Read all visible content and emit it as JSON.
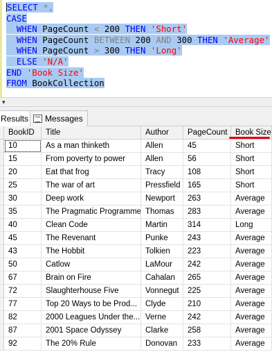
{
  "editor": {
    "lines": [
      [
        {
          "t": "SELECT",
          "c": "kw"
        },
        {
          "t": " *,",
          "c": "gry"
        }
      ],
      [
        {
          "t": "CASE",
          "c": "kw"
        }
      ],
      [
        {
          "t": "  WHEN ",
          "c": "kw"
        },
        {
          "t": "PageCount ",
          "c": ""
        },
        {
          "t": "< ",
          "c": "gry"
        },
        {
          "t": "200 ",
          "c": ""
        },
        {
          "t": "THEN ",
          "c": "kw"
        },
        {
          "t": "'Short'",
          "c": "str"
        }
      ],
      [
        {
          "t": "  WHEN ",
          "c": "kw"
        },
        {
          "t": "PageCount ",
          "c": ""
        },
        {
          "t": "BETWEEN ",
          "c": "gry"
        },
        {
          "t": "200 ",
          "c": ""
        },
        {
          "t": "AND ",
          "c": "gry"
        },
        {
          "t": "300 ",
          "c": ""
        },
        {
          "t": "THEN ",
          "c": "kw"
        },
        {
          "t": "'Average'",
          "c": "str"
        }
      ],
      [
        {
          "t": "  WHEN ",
          "c": "kw"
        },
        {
          "t": "PageCount ",
          "c": ""
        },
        {
          "t": "> ",
          "c": "gry"
        },
        {
          "t": "300 ",
          "c": ""
        },
        {
          "t": "THEN ",
          "c": "kw"
        },
        {
          "t": "'Long'",
          "c": "str"
        }
      ],
      [
        {
          "t": "  ELSE ",
          "c": "kw"
        },
        {
          "t": "'N/A'",
          "c": "str"
        }
      ],
      [
        {
          "t": "END ",
          "c": "kw"
        },
        {
          "t": "'Book Size'",
          "c": "str"
        }
      ],
      [
        {
          "t": "FROM ",
          "c": "kw"
        },
        {
          "t": "BookCollection",
          "c": ""
        }
      ]
    ]
  },
  "tabs": {
    "results": "Results",
    "messages": "Messages"
  },
  "grid": {
    "columns": [
      "BookID",
      "Title",
      "Author",
      "PageCount",
      "Book Size"
    ],
    "rows": [
      [
        "10",
        "As a man thinketh",
        "Allen",
        "45",
        "Short"
      ],
      [
        "15",
        "From poverty to power",
        "Allen",
        "56",
        "Short"
      ],
      [
        "20",
        "Eat that frog",
        "Tracy",
        "108",
        "Short"
      ],
      [
        "25",
        "The war of art",
        "Pressfield",
        "165",
        "Short"
      ],
      [
        "30",
        "Deep work",
        "Newport",
        "263",
        "Average"
      ],
      [
        "35",
        "The Pragmatic Programmer",
        "Thomas",
        "283",
        "Average"
      ],
      [
        "40",
        "Clean Code",
        "Martin",
        "314",
        "Long"
      ],
      [
        "45",
        "The Revenant",
        "Punke",
        "243",
        "Average"
      ],
      [
        "43",
        "The Hobbit",
        "Tolkien",
        "223",
        "Average"
      ],
      [
        "50",
        "Catlow",
        "LaMour",
        "242",
        "Average"
      ],
      [
        "67",
        "Brain on Fire",
        "Cahalan",
        "265",
        "Average"
      ],
      [
        "72",
        "Slaughterhouse Five",
        "Vonnegut",
        "225",
        "Average"
      ],
      [
        "77",
        "Top 20 Ways to be Prod...",
        "Clyde",
        "210",
        "Average"
      ],
      [
        "82",
        "2000 Leagues Under the...",
        "Verne",
        "242",
        "Average"
      ],
      [
        "87",
        "2001 Space Odyssey",
        "Clarke",
        "258",
        "Average"
      ],
      [
        "92",
        "The 20% Rule",
        "Donovan",
        "233",
        "Average"
      ]
    ]
  },
  "colors": {
    "selection": "#a9cbf3",
    "keyword": "#0000ff",
    "string": "#ff0000",
    "operator": "#808080",
    "highlight_underline": "#e3000f"
  }
}
